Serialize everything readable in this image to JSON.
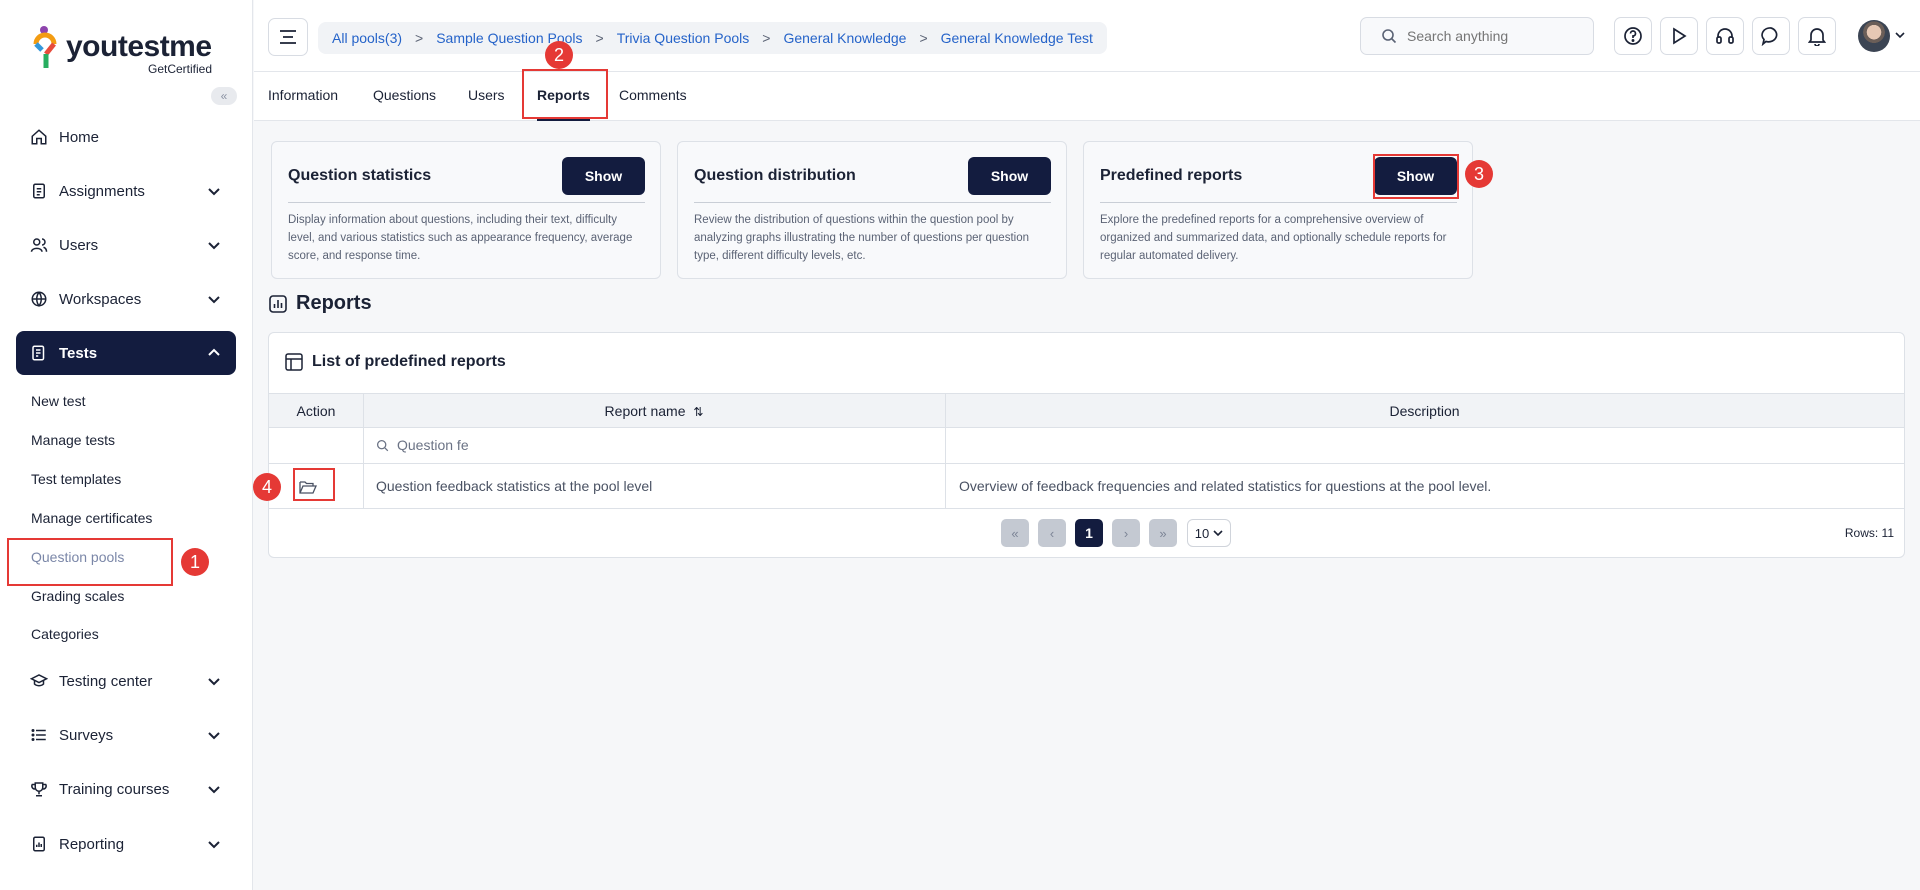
{
  "brand": {
    "name": "youtestme",
    "sub": "GetCertified",
    "collapse": "«"
  },
  "sidebar": {
    "items": [
      {
        "label": "Home",
        "icon": "home-icon"
      },
      {
        "label": "Assignments",
        "icon": "clipboard-icon"
      },
      {
        "label": "Users",
        "icon": "users-icon"
      },
      {
        "label": "Workspaces",
        "icon": "globe-icon"
      },
      {
        "label": "Tests",
        "icon": "test-icon"
      },
      {
        "label": "Testing center",
        "icon": "graduation-cap-icon"
      },
      {
        "label": "Surveys",
        "icon": "list-icon"
      },
      {
        "label": "Training courses",
        "icon": "trophy-icon"
      },
      {
        "label": "Reporting",
        "icon": "report-icon"
      }
    ],
    "tests_sub": [
      {
        "label": "New test"
      },
      {
        "label": "Manage tests"
      },
      {
        "label": "Test templates"
      },
      {
        "label": "Manage certificates"
      },
      {
        "label": "Question pools"
      },
      {
        "label": "Grading scales"
      },
      {
        "label": "Categories"
      }
    ]
  },
  "header": {
    "breadcrumb": [
      "All pools(3)",
      "Sample Question Pools",
      "Trivia Question Pools",
      "General Knowledge",
      "General Knowledge Test"
    ],
    "separator": ">",
    "search_placeholder": "Search anything"
  },
  "tabs": [
    {
      "label": "Information"
    },
    {
      "label": "Questions"
    },
    {
      "label": "Users"
    },
    {
      "label": "Reports"
    },
    {
      "label": "Comments"
    }
  ],
  "active_tab": "Reports",
  "cards": [
    {
      "title": "Question statistics",
      "button": "Show",
      "desc": "Display information about questions, including their text, difficulty level, and various statistics such as appearance frequency, average score, and response time."
    },
    {
      "title": "Question distribution",
      "button": "Show",
      "desc": "Review the distribution of questions within the question pool by analyzing graphs illustrating the number of questions per question type, different difficulty levels, etc."
    },
    {
      "title": "Predefined reports",
      "button": "Show",
      "desc": "Explore the predefined reports for a comprehensive overview of organized and summarized data, and optionally schedule reports for regular automated delivery."
    }
  ],
  "reports": {
    "section_title": "Reports",
    "panel_title": "List of predefined reports",
    "columns": {
      "action": "Action",
      "name": "Report name",
      "name_sort": "⇅",
      "description": "Description"
    },
    "filter_value": "Question fe",
    "rows": [
      {
        "name": "Question feedback statistics at the pool level",
        "description": "Overview of feedback frequencies and related statistics for questions at the pool level."
      }
    ],
    "pager": {
      "first": "«",
      "prev": "‹",
      "current": "1",
      "next": "›",
      "last": "»",
      "page_size": "10",
      "rows": "Rows: 11"
    }
  },
  "annotations": [
    "1",
    "2",
    "3",
    "4"
  ],
  "colors": {
    "primary": "#131c3f",
    "link": "#2563c9",
    "annotation": "#e53935"
  }
}
